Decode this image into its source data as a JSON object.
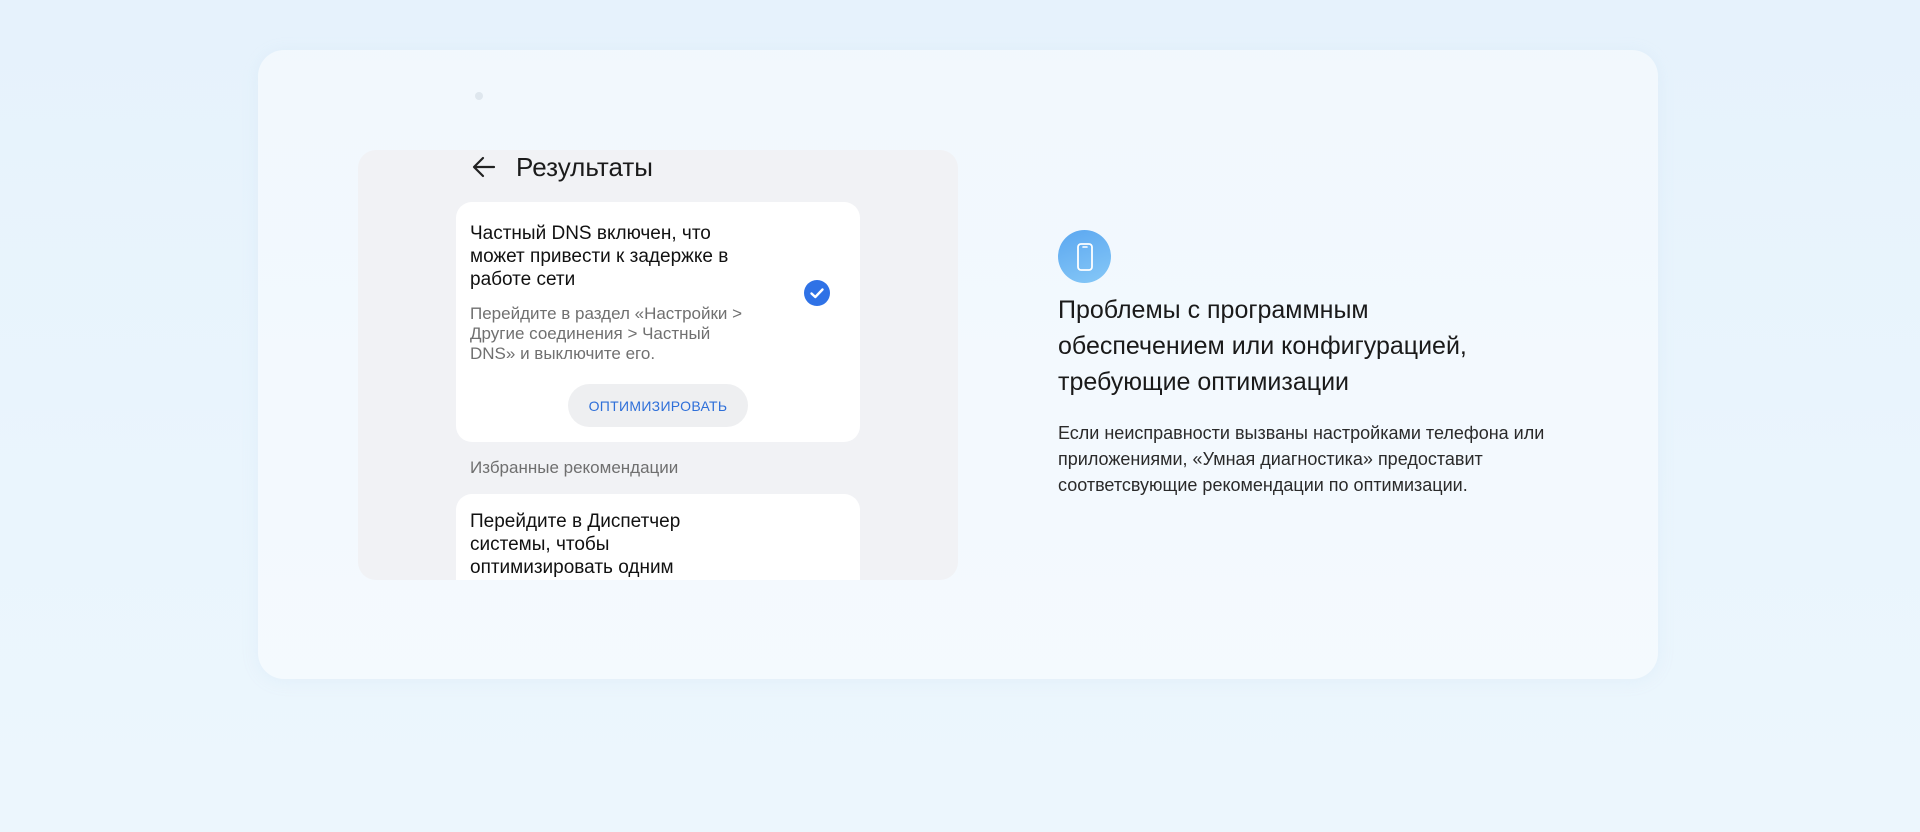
{
  "phone": {
    "title": "Результаты",
    "result_card": {
      "title": "Частный DNS включен, что может привести к задержке в работе сети",
      "description": "Перейдите в раздел «Настройки > Другие соединения > Частный DNS» и выключите его.",
      "button_label": "ОПТИМИЗИРОВАТЬ"
    },
    "section_label": "Избранные рекомендации",
    "recommendation": {
      "title": "Перейдите в Диспетчер системы, чтобы оптимизировать одним"
    }
  },
  "feature": {
    "icon": "phone-icon",
    "title": "Проблемы с программным обеспечением или конфигурацией, требующие оптимизации",
    "description": "Если неисправности вызваны настройками телефона или приложениями, «Умная диагностика» предоставит соответсвующие рекомендации по оптимизации."
  },
  "colors": {
    "accent": "#2e6fd9",
    "check": "#2f72e6",
    "icon_gradient_start": "#5ba7f0",
    "icon_gradient_end": "#86c8f7"
  }
}
